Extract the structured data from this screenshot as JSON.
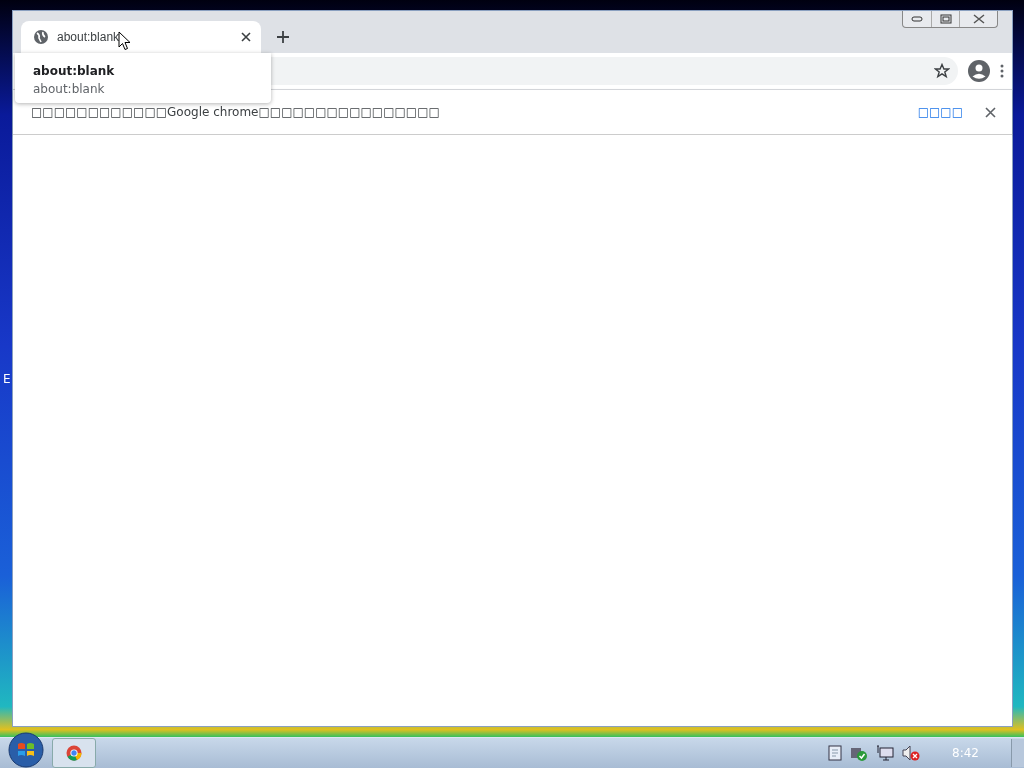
{
  "desktop": {
    "edge_label": "E"
  },
  "window": {
    "tabs": [
      {
        "title": "about:blank",
        "selected": true
      }
    ],
    "hover_card": {
      "title": "about:blank",
      "url": "about:blank"
    },
    "infobar": {
      "message": "□□□□□□□□□□□□Google chrome□□□□□□□□□□□□□□□□",
      "link": "□□□□"
    }
  },
  "taskbar": {
    "apps": [
      {
        "selected": false
      }
    ],
    "clock": "8:42"
  }
}
